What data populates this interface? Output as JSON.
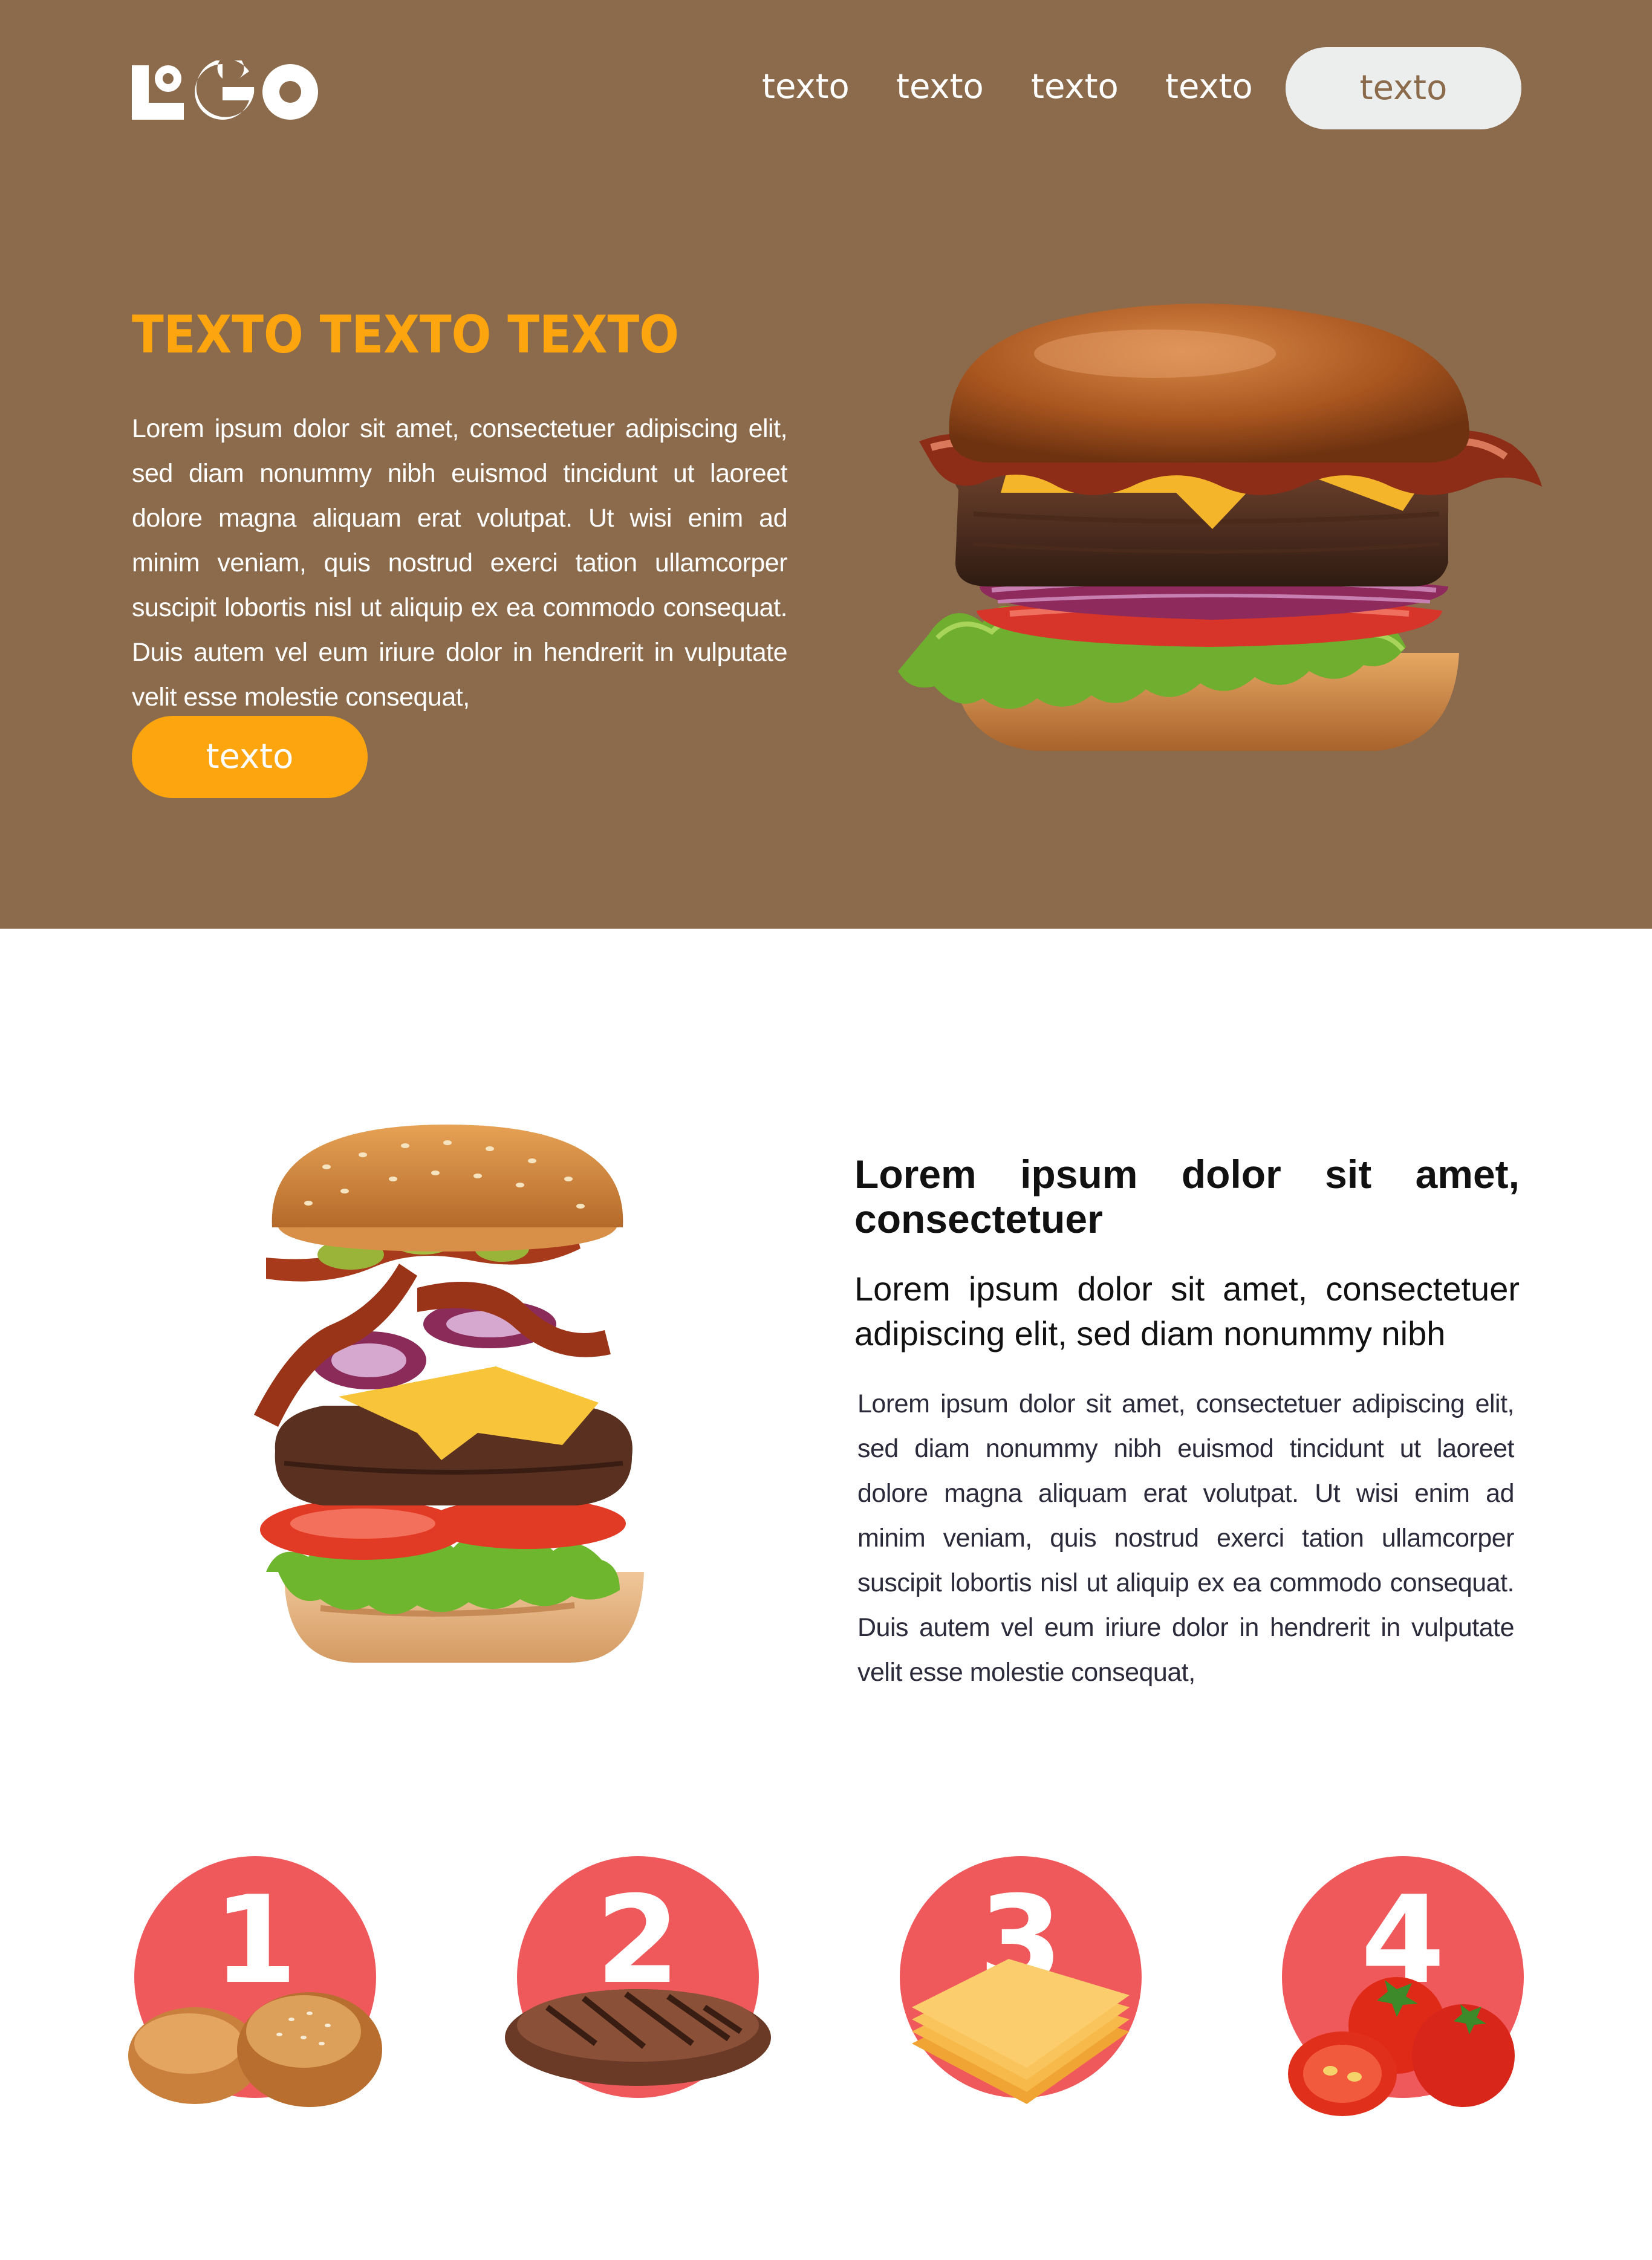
{
  "header": {
    "logo_text": "LOGO",
    "nav": [
      "texto",
      "texto",
      "texto",
      "texto"
    ],
    "cta_label": "texto"
  },
  "hero": {
    "title": "TEXTO TEXTO TEXTO",
    "body": "Lorem ipsum dolor sit amet, consectetuer adipiscing elit, sed diam nonummy nibh euismod tincidunt ut laoreet dolore magna aliquam erat volutpat. Ut wisi enim ad minim veniam, quis nostrud exerci tation ullamcorper suscipit lobortis nisl ut aliquip ex ea commodo consequat. Duis autem vel eum iriure dolor in hendrerit in vulputate velit esse molestie consequat,",
    "button_label": "texto"
  },
  "about": {
    "heading": "Lorem ipsum dolor sit amet, consectetuer",
    "subheading": "Lorem ipsum dolor sit amet, consectetuer adipiscing elit, sed diam nonummy nibh",
    "body": "Lorem ipsum dolor sit amet, consectetuer adipiscing elit, sed diam nonummy nibh euismod tincidunt ut laoreet dolore magna aliquam erat volutpat. Ut wisi enim ad minim veniam, quis nostrud exerci tation ullamcorper suscipit lobortis nisl ut aliquip ex ea commodo consequat. Duis autem vel eum iriure dolor in hendrerit in vulputate velit esse molestie consequat,"
  },
  "ingredients": [
    {
      "number": "1",
      "icon": "burger-buns-icon"
    },
    {
      "number": "2",
      "icon": "beef-patty-icon"
    },
    {
      "number": "3",
      "icon": "cheese-slices-icon"
    },
    {
      "number": "4",
      "icon": "tomatoes-icon"
    }
  ],
  "colors": {
    "hero_bg": "#8b6b4c",
    "accent_orange": "#fda50f",
    "nav_cta_bg": "#eceeee",
    "ingredient_circle": "#f0595c"
  }
}
